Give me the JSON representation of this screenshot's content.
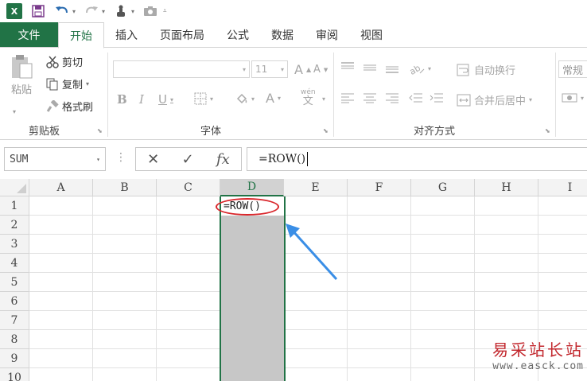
{
  "quick_access": {
    "app_icon": "excel-logo",
    "app_letter": "X",
    "items": [
      "save-icon",
      "undo-icon",
      "redo-icon",
      "touch-mode-icon",
      "camera-icon",
      "customize-icon"
    ]
  },
  "tabs": {
    "file": "文件",
    "items": [
      "开始",
      "插入",
      "页面布局",
      "公式",
      "数据",
      "审阅",
      "视图"
    ],
    "active": "开始"
  },
  "ribbon": {
    "clipboard": {
      "paste": "粘贴",
      "cut": "剪切",
      "copy": "复制",
      "format_painter": "格式刷",
      "label": "剪贴板"
    },
    "font": {
      "font_name": "",
      "font_size": "11",
      "grow": "A",
      "shrink": "A",
      "bold": "B",
      "italic": "I",
      "underline": "U",
      "font_color": "A",
      "phonetic": "wén",
      "phonetic_char": "文",
      "label": "字体"
    },
    "alignment": {
      "wrap_text": "自动换行",
      "merge_center": "合并后居中",
      "label": "对齐方式"
    },
    "number": {
      "format": "常规"
    }
  },
  "formula_bar": {
    "name_box": "SUM",
    "cancel_symbol": "✕",
    "enter_symbol": "✓",
    "fx_label": "fx",
    "formula": "=ROW()"
  },
  "grid": {
    "columns": [
      "A",
      "B",
      "C",
      "D",
      "E",
      "F",
      "G",
      "H",
      "I"
    ],
    "rows": [
      "1",
      "2",
      "3",
      "4",
      "5",
      "6",
      "7",
      "8",
      "9",
      "10"
    ],
    "selected_column": "D",
    "active_cell_text": "=ROW()"
  },
  "watermark": {
    "chinese": "易采站长站",
    "url": "www.easck.com"
  },
  "colors": {
    "excel_green": "#217346",
    "annotation_red": "#d9262b",
    "arrow_blue": "#3a8ee6",
    "selection_gray": "#c7c7c7"
  }
}
